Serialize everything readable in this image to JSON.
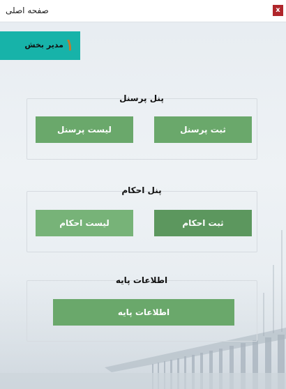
{
  "window": {
    "title": "صفحه اصلی",
    "close_label": "x"
  },
  "department": {
    "number": "۱",
    "label": "مدیر بخش"
  },
  "groups": [
    {
      "title": "پنل پرسنل",
      "buttons": [
        "ثبت پرسنل",
        "لیست پرسنل"
      ]
    },
    {
      "title": "پنل احکام",
      "buttons": [
        "ثبت احکام",
        "لیست احکام"
      ]
    },
    {
      "title": "اطلاعات پایه",
      "buttons": [
        "اطلاعات پایه"
      ]
    }
  ],
  "colors": {
    "accent_teal": "#17b3a9",
    "button_green": "#6aa86b",
    "close_red": "#b0262b"
  }
}
